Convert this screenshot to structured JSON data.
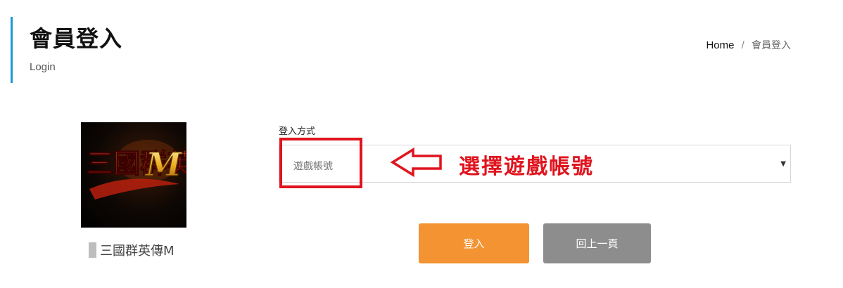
{
  "header": {
    "title": "會員登入",
    "subtitle": "Login",
    "breadcrumb": {
      "home": "Home",
      "separator": "/",
      "current": "會員登入"
    }
  },
  "game": {
    "logo_text": "三國群英傳M",
    "name": "三國群英傳M"
  },
  "login_form": {
    "method_label": "登入方式",
    "selected_method": "遊戲帳號",
    "caret": "▼"
  },
  "annotation": {
    "text": "選擇遊戲帳號",
    "color": "#e0141e"
  },
  "buttons": {
    "login": "登入",
    "back": "回上一頁"
  },
  "colors": {
    "accent": "#1a9ad6",
    "login_button": "#f39332",
    "back_button": "#8d8d8d"
  }
}
